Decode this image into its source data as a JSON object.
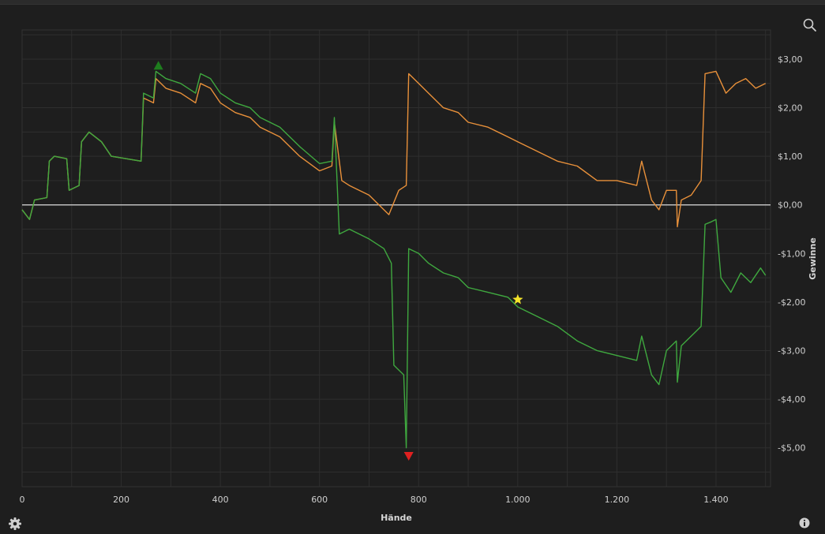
{
  "chart_data": {
    "type": "line",
    "xlabel": "Hände",
    "ylabel": "Gewinne",
    "xlim": [
      0,
      1510
    ],
    "ylim": [
      -5.8,
      3.6
    ],
    "x_ticks": [
      0,
      200,
      400,
      600,
      800,
      1000,
      1200,
      1400
    ],
    "x_tick_labels": [
      "0",
      "200",
      "400",
      "600",
      "800",
      "1.000",
      "1.200",
      "1.400"
    ],
    "y_ticks": [
      3,
      2,
      1,
      0,
      -1,
      -2,
      -3,
      -4,
      -5
    ],
    "y_tick_labels": [
      "$3,00",
      "$2,00",
      "$1,00",
      "$0,00",
      "-$1,00",
      "-$2,00",
      "-$3,00",
      "-$4,00",
      "-$5,00"
    ],
    "grid": true,
    "zero_line_color": "#bdbdbd",
    "series": [
      {
        "color": "#e8903a",
        "points": [
          [
            0,
            -0.1
          ],
          [
            15,
            -0.3
          ],
          [
            25,
            0.1
          ],
          [
            50,
            0.15
          ],
          [
            55,
            0.9
          ],
          [
            65,
            1.0
          ],
          [
            90,
            0.95
          ],
          [
            95,
            0.3
          ],
          [
            115,
            0.4
          ],
          [
            120,
            1.3
          ],
          [
            135,
            1.5
          ],
          [
            160,
            1.3
          ],
          [
            180,
            1.0
          ],
          [
            240,
            0.9
          ],
          [
            245,
            2.2
          ],
          [
            265,
            2.1
          ],
          [
            270,
            2.6
          ],
          [
            290,
            2.4
          ],
          [
            320,
            2.3
          ],
          [
            350,
            2.1
          ],
          [
            360,
            2.5
          ],
          [
            380,
            2.4
          ],
          [
            400,
            2.1
          ],
          [
            430,
            1.9
          ],
          [
            460,
            1.8
          ],
          [
            480,
            1.6
          ],
          [
            520,
            1.4
          ],
          [
            560,
            1.0
          ],
          [
            600,
            0.7
          ],
          [
            625,
            0.8
          ],
          [
            630,
            1.7
          ],
          [
            645,
            0.5
          ],
          [
            660,
            0.4
          ],
          [
            680,
            0.3
          ],
          [
            700,
            0.2
          ],
          [
            720,
            0.0
          ],
          [
            740,
            -0.2
          ],
          [
            760,
            0.3
          ],
          [
            775,
            0.4
          ],
          [
            780,
            2.7
          ],
          [
            800,
            2.5
          ],
          [
            820,
            2.3
          ],
          [
            850,
            2.0
          ],
          [
            880,
            1.9
          ],
          [
            900,
            1.7
          ],
          [
            940,
            1.6
          ],
          [
            980,
            1.4
          ],
          [
            1000,
            1.3
          ],
          [
            1040,
            1.1
          ],
          [
            1080,
            0.9
          ],
          [
            1120,
            0.8
          ],
          [
            1160,
            0.5
          ],
          [
            1200,
            0.5
          ],
          [
            1240,
            0.4
          ],
          [
            1250,
            0.9
          ],
          [
            1270,
            0.1
          ],
          [
            1285,
            -0.1
          ],
          [
            1300,
            0.3
          ],
          [
            1320,
            0.3
          ],
          [
            1322,
            -0.45
          ],
          [
            1330,
            0.1
          ],
          [
            1350,
            0.2
          ],
          [
            1370,
            0.5
          ],
          [
            1378,
            2.7
          ],
          [
            1400,
            2.75
          ],
          [
            1420,
            2.3
          ],
          [
            1440,
            2.5
          ],
          [
            1460,
            2.6
          ],
          [
            1480,
            2.4
          ],
          [
            1500,
            2.5
          ]
        ]
      },
      {
        "color": "#3fa83f",
        "points": [
          [
            0,
            -0.1
          ],
          [
            15,
            -0.3
          ],
          [
            25,
            0.1
          ],
          [
            50,
            0.15
          ],
          [
            55,
            0.9
          ],
          [
            65,
            1.0
          ],
          [
            90,
            0.95
          ],
          [
            95,
            0.3
          ],
          [
            115,
            0.4
          ],
          [
            120,
            1.3
          ],
          [
            135,
            1.5
          ],
          [
            160,
            1.3
          ],
          [
            180,
            1.0
          ],
          [
            240,
            0.9
          ],
          [
            245,
            2.3
          ],
          [
            265,
            2.2
          ],
          [
            270,
            2.75
          ],
          [
            290,
            2.6
          ],
          [
            320,
            2.5
          ],
          [
            350,
            2.3
          ],
          [
            360,
            2.7
          ],
          [
            380,
            2.6
          ],
          [
            400,
            2.3
          ],
          [
            430,
            2.1
          ],
          [
            460,
            2.0
          ],
          [
            480,
            1.8
          ],
          [
            520,
            1.6
          ],
          [
            560,
            1.2
          ],
          [
            600,
            0.85
          ],
          [
            625,
            0.9
          ],
          [
            630,
            1.8
          ],
          [
            640,
            -0.6
          ],
          [
            660,
            -0.5
          ],
          [
            700,
            -0.7
          ],
          [
            730,
            -0.9
          ],
          [
            745,
            -1.2
          ],
          [
            750,
            -3.3
          ],
          [
            770,
            -3.5
          ],
          [
            775,
            -5.0
          ],
          [
            780,
            -0.9
          ],
          [
            800,
            -1.0
          ],
          [
            820,
            -1.2
          ],
          [
            850,
            -1.4
          ],
          [
            880,
            -1.5
          ],
          [
            900,
            -1.7
          ],
          [
            940,
            -1.8
          ],
          [
            980,
            -1.9
          ],
          [
            1000,
            -2.1
          ],
          [
            1040,
            -2.3
          ],
          [
            1080,
            -2.5
          ],
          [
            1120,
            -2.8
          ],
          [
            1160,
            -3.0
          ],
          [
            1200,
            -3.1
          ],
          [
            1240,
            -3.2
          ],
          [
            1250,
            -2.7
          ],
          [
            1270,
            -3.5
          ],
          [
            1285,
            -3.7
          ],
          [
            1300,
            -3.0
          ],
          [
            1320,
            -2.8
          ],
          [
            1322,
            -3.65
          ],
          [
            1330,
            -2.9
          ],
          [
            1350,
            -2.7
          ],
          [
            1370,
            -2.5
          ],
          [
            1378,
            -0.4
          ],
          [
            1390,
            -0.35
          ],
          [
            1400,
            -0.3
          ],
          [
            1410,
            -1.5
          ],
          [
            1430,
            -1.8
          ],
          [
            1450,
            -1.4
          ],
          [
            1470,
            -1.6
          ],
          [
            1490,
            -1.3
          ],
          [
            1500,
            -1.45
          ]
        ]
      }
    ],
    "markers": [
      {
        "shape": "triangle-up",
        "color": "#1e7d1e",
        "x": 275,
        "y": 2.85
      },
      {
        "shape": "triangle-down",
        "color": "#e02020",
        "x": 780,
        "y": -5.15
      },
      {
        "shape": "star",
        "color": "#f5e52a",
        "x": 1000,
        "y": -1.95
      }
    ]
  },
  "icons": {
    "zoom": "magnifier-icon",
    "settings": "gear-icon",
    "info": "info-icon"
  }
}
